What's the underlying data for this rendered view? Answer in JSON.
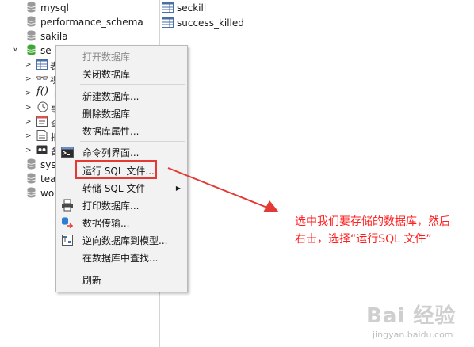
{
  "sidebar": {
    "databases": [
      {
        "name": "mysql"
      },
      {
        "name": "performance_schema"
      },
      {
        "name": "sakila"
      },
      {
        "name": "seckill",
        "visible": "se"
      },
      {
        "name": "sys",
        "visible": "sys"
      },
      {
        "name": "test",
        "visible": "tea"
      },
      {
        "name": "world",
        "visible": "wo"
      }
    ],
    "children_partial": [
      "表",
      "视图",
      "函数",
      "事件",
      "查询",
      "报表",
      "备份"
    ]
  },
  "tables": [
    "seckill",
    "success_killed"
  ],
  "menu": {
    "items": [
      {
        "label": "打开数据库",
        "disabled": true
      },
      {
        "label": "关闭数据库"
      },
      {
        "label": "新建数据库..."
      },
      {
        "label": "删除数据库"
      },
      {
        "label": "数据库属性..."
      },
      {
        "label": "命令列界面..."
      },
      {
        "label": "运行 SQL 文件..."
      },
      {
        "label": "转储 SQL 文件"
      },
      {
        "label": "打印数据库..."
      },
      {
        "label": "数据传输..."
      },
      {
        "label": "逆向数据库到模型..."
      },
      {
        "label": "在数据库中查找..."
      },
      {
        "label": "刷新"
      }
    ]
  },
  "annotation": {
    "line1": "选中我们要存储的数据库，然后",
    "line2": "右击，选择“运行SQL 文件”"
  },
  "watermark": {
    "main": "Bai 经验",
    "sub": "jingyan.baidu.com"
  },
  "colors": {
    "highlight": "#e53935",
    "annotation": "#ff1e1e",
    "db_icon": "#8a8a8a",
    "db_icon_active": "#3fa535"
  }
}
